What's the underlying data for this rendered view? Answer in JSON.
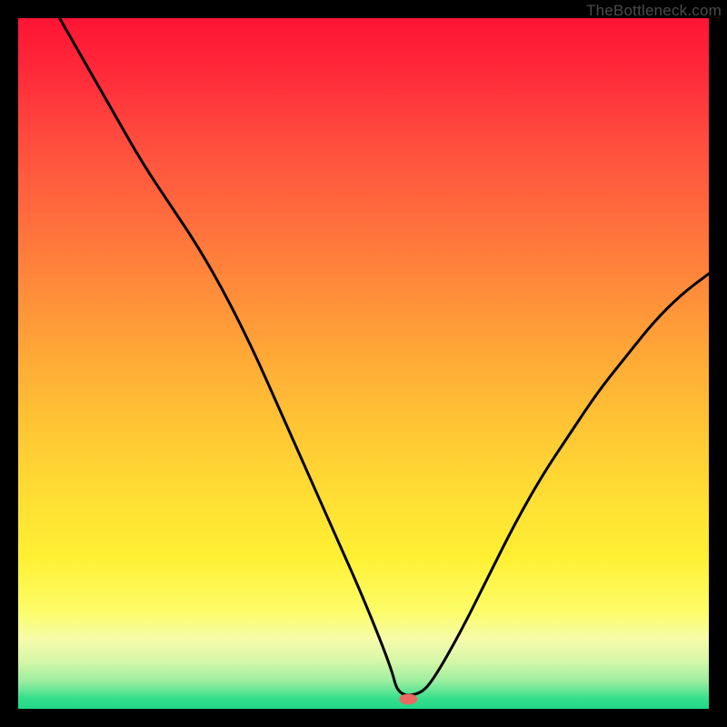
{
  "attribution": "TheBottleneck.com",
  "curve_color": "#000000",
  "curve_stroke_width": 3,
  "marker": {
    "fill": "#e76a63",
    "rx": 10,
    "ry": 6
  },
  "chart_data": {
    "type": "line",
    "title": "",
    "xlabel": "",
    "ylabel": "",
    "xlim": [
      0,
      100
    ],
    "ylim": [
      0,
      100
    ],
    "series": [
      {
        "name": "curve",
        "x": [
          6,
          10,
          14,
          18,
          22,
          26,
          30,
          34,
          38,
          42,
          46,
          50,
          54,
          55,
          58,
          60,
          64,
          68,
          72,
          76,
          80,
          84,
          88,
          92,
          96,
          100
        ],
        "y": [
          100,
          93,
          86,
          79,
          73,
          67,
          60,
          52,
          43,
          34,
          25,
          16,
          6,
          2,
          2,
          4,
          11,
          19,
          27,
          34,
          40,
          46,
          51,
          56,
          60,
          63
        ]
      }
    ],
    "marker_point": {
      "x": 56.5,
      "y": 1.4
    }
  },
  "gradient_stops": [
    {
      "pct": 0,
      "color": "#ff1434"
    },
    {
      "pct": 18,
      "color": "#ff4d3e"
    },
    {
      "pct": 38,
      "color": "#ff883a"
    },
    {
      "pct": 58,
      "color": "#ffc234"
    },
    {
      "pct": 78,
      "color": "#fff033"
    },
    {
      "pct": 93,
      "color": "#d7f7a8"
    },
    {
      "pct": 100,
      "color": "#1fd98a"
    }
  ]
}
